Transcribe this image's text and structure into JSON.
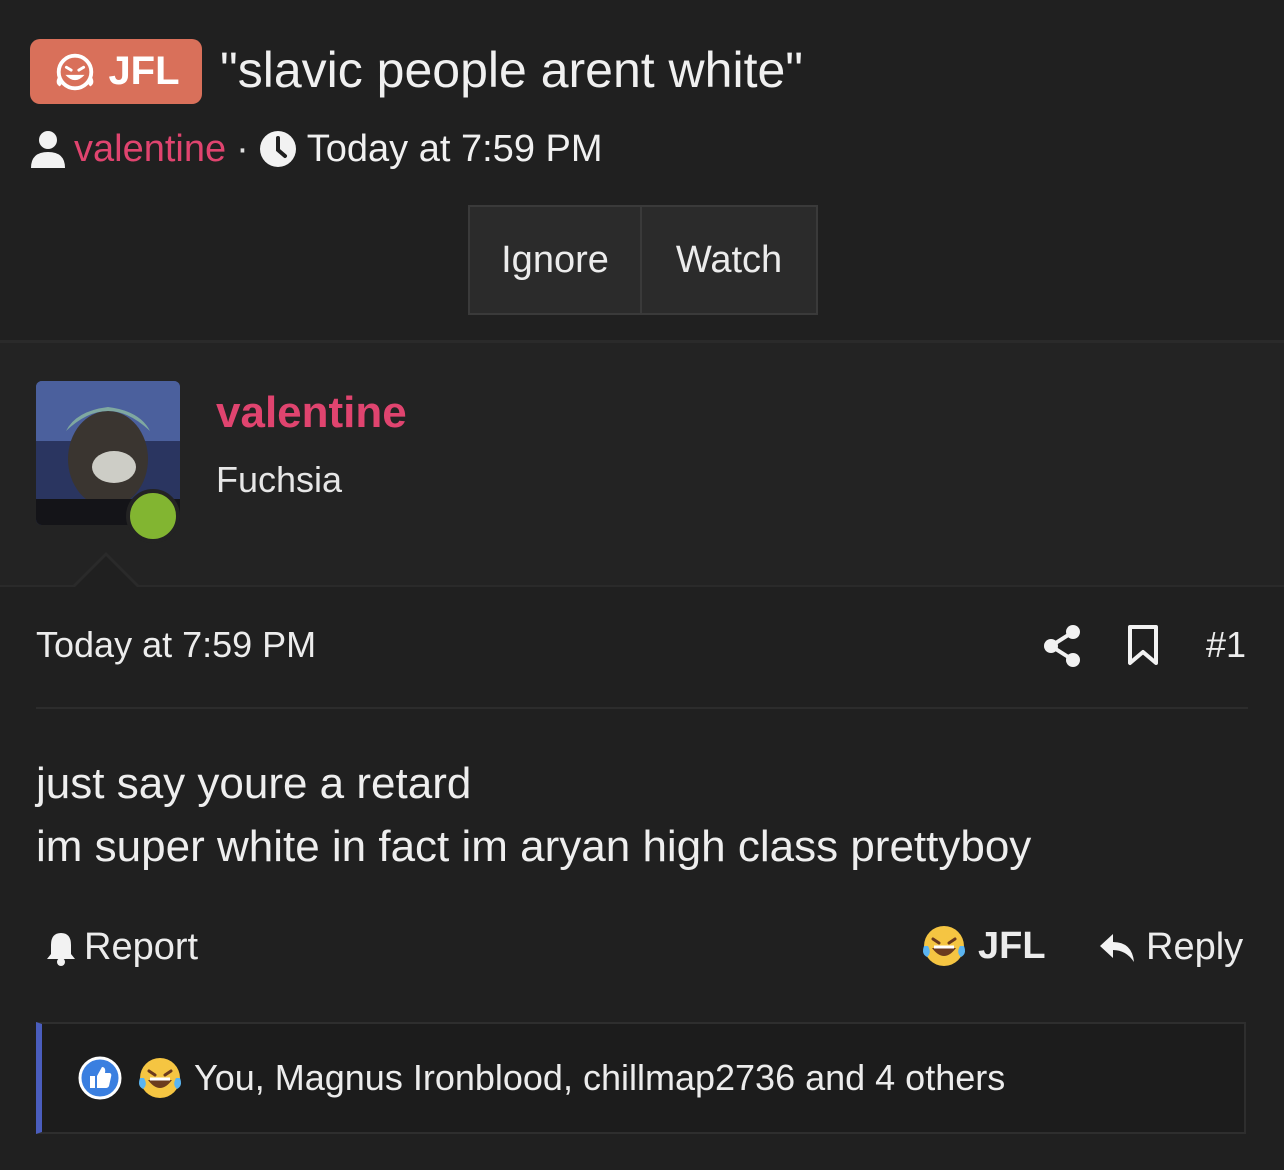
{
  "thread": {
    "prefix": "JFL",
    "title": "\"slavic people arent white\"",
    "author": "valentine",
    "separator": "·",
    "time": "Today at 7:59 PM"
  },
  "actions": {
    "ignore": "Ignore",
    "watch": "Watch"
  },
  "user": {
    "name": "valentine",
    "title": "Fuchsia",
    "online": true
  },
  "post": {
    "time": "Today at 7:59 PM",
    "number": "#1",
    "body_lines": [
      "just say youre a retard",
      "im super white in fact im aryan high class prettyboy"
    ],
    "report": "Report",
    "react": "JFL",
    "reply": "Reply"
  },
  "reactions": {
    "summary": "You, Magnus Ironblood, chillmap2736 and 4 others",
    "icons": [
      "like-icon",
      "laugh-cry-icon"
    ]
  },
  "colors": {
    "background": "#202020",
    "prefix_badge": "#d9705a",
    "username": "#e0446f",
    "online": "#82b531",
    "reaction_accent": "#4a5dbd"
  }
}
